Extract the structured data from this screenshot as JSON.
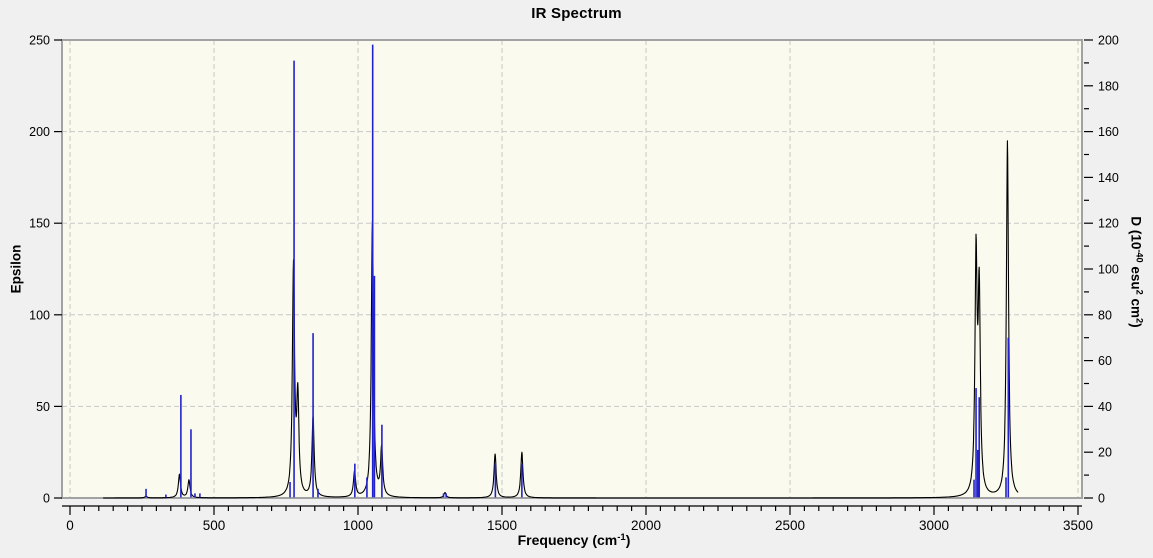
{
  "window": {
    "background": "#f0f0f0"
  },
  "chart": {
    "title": "IR Spectrum",
    "x_axis": {
      "label_plain": "Frequency (cm⁻¹)",
      "label_parts": [
        {
          "t": "Frequency (cm"
        },
        {
          "t": "-1",
          "sup": true
        },
        {
          "t": ")"
        }
      ],
      "min": 0,
      "max": 3500,
      "major_step": 500,
      "minor_step": 50
    },
    "y_left": {
      "label_plain": "Epsilon",
      "label_parts": [
        {
          "t": "Epsilon"
        }
      ],
      "min": 0,
      "max": 250,
      "major_step": 50
    },
    "y_right": {
      "label_plain": "D (10⁻⁴⁰ esu² cm²)",
      "label_parts": [
        {
          "t": "D (10"
        },
        {
          "t": "-40",
          "sup": true
        },
        {
          "t": " esu"
        },
        {
          "t": "2",
          "sup": true
        },
        {
          "t": " cm"
        },
        {
          "t": "2",
          "sup": true
        },
        {
          "t": ")"
        }
      ],
      "min": 0,
      "max": 200,
      "major_step": 20,
      "minor_step": 10
    },
    "colors": {
      "plot_bg": "#fafaee",
      "outer_bg": "#f0f0f0",
      "grid": "#c8c8c8",
      "frame": "#a2a2a2",
      "epsilon_curve": "#000000",
      "d_sticks": "#2222cc",
      "text": "#000000"
    },
    "grid_style": "dashed"
  },
  "chart_data": {
    "type": "line",
    "title": "IR Spectrum",
    "xlabel": "Frequency (cm⁻¹)",
    "ylabel": "Epsilon",
    "ylabel_right": "D (10⁻⁴⁰ esu² cm²)",
    "xlim": [
      0,
      3500
    ],
    "ylim_left": [
      0,
      250
    ],
    "ylim_right": [
      0,
      200
    ],
    "grid": true,
    "legend": false,
    "series": [
      {
        "name": "epsilon-lorentzian-curve",
        "axis": "left",
        "style": "lorentzian_sum",
        "hwhm_cm1": 4.5,
        "x_range": [
          115,
          3292
        ],
        "peaks": [
          [
            264,
            1
          ],
          [
            380,
            13
          ],
          [
            413,
            10
          ],
          [
            776,
            130
          ],
          [
            791,
            63
          ],
          [
            844,
            45
          ],
          [
            988,
            15
          ],
          [
            1031,
            5
          ],
          [
            1050,
            151
          ],
          [
            1082,
            29
          ],
          [
            1302,
            3
          ],
          [
            1476,
            24
          ],
          [
            1569,
            25
          ],
          [
            3146,
            144
          ],
          [
            3157,
            126
          ],
          [
            3255,
            195
          ]
        ]
      },
      {
        "name": "d-strength-sticks",
        "axis": "right",
        "style": "stick",
        "points": [
          [
            264,
            4
          ],
          [
            333,
            1.5
          ],
          [
            385,
            45
          ],
          [
            420,
            30
          ],
          [
            434,
            2
          ],
          [
            451,
            2
          ],
          [
            764,
            7
          ],
          [
            778,
            191
          ],
          [
            844,
            72
          ],
          [
            861,
            4
          ],
          [
            989,
            15
          ],
          [
            1031,
            9
          ],
          [
            1051,
            198
          ],
          [
            1057,
            97
          ],
          [
            1083,
            32
          ],
          [
            1297,
            2
          ],
          [
            1306,
            2
          ],
          [
            1477,
            15
          ],
          [
            1569,
            15
          ],
          [
            3139,
            8
          ],
          [
            3146,
            48
          ],
          [
            3152,
            21
          ],
          [
            3157,
            44
          ],
          [
            3250,
            9
          ],
          [
            3258,
            70
          ]
        ]
      }
    ]
  }
}
